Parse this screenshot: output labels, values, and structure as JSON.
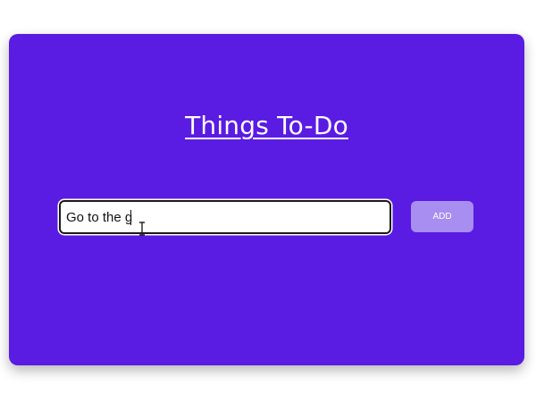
{
  "header": {
    "title": "Things To-Do"
  },
  "todo_form": {
    "input_value": "Go to the g",
    "add_label": "ADD"
  },
  "colors": {
    "card_background": "#5a1be3",
    "add_button": "#a78ef0",
    "title_text": "#ffffff"
  },
  "icons": {
    "cursor": "text-cursor-ibeam-icon"
  }
}
